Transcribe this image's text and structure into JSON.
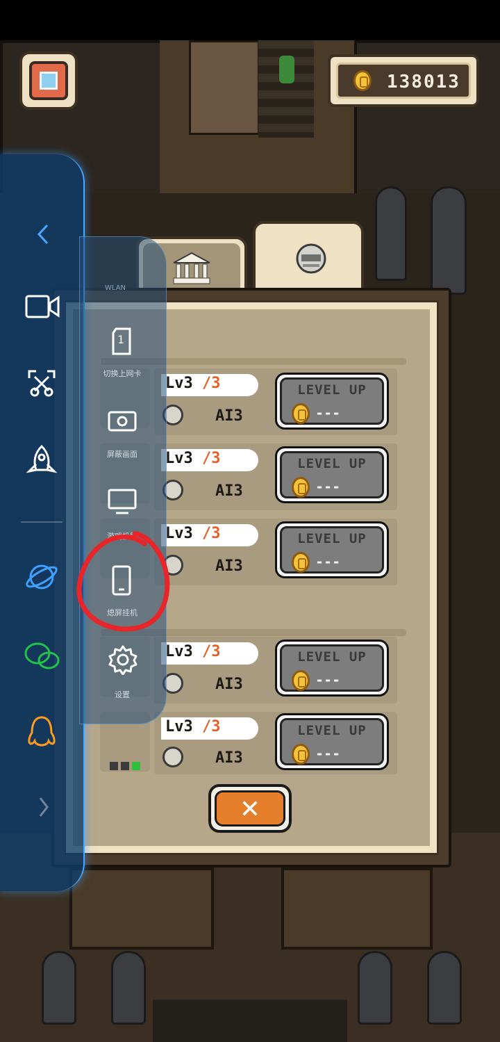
{
  "header": {
    "coins": "138013"
  },
  "tabs": [
    {
      "name": "museum",
      "icon": "museum-icon"
    },
    {
      "name": "robot",
      "icon": "robot-icon"
    }
  ],
  "upgrade_rows": [
    {
      "level": "Lv3",
      "max": "/3",
      "ai": "AI3",
      "button": "LEVEL UP",
      "cost": "---"
    },
    {
      "level": "Lv3",
      "max": "/3",
      "ai": "AI3",
      "button": "LEVEL UP",
      "cost": "---"
    },
    {
      "level": "Lv3",
      "max": "/3",
      "ai": "AI3",
      "button": "LEVEL UP",
      "cost": "---"
    },
    {
      "level": "Lv3",
      "max": "/3",
      "ai": "AI3",
      "button": "LEVEL UP",
      "cost": "---"
    },
    {
      "level": "Lv3",
      "max": "/3",
      "ai": "AI3",
      "button": "LEVEL UP",
      "cost": "---"
    }
  ],
  "close_button": "✕",
  "sidebar": {
    "items": [
      "back",
      "screen-record",
      "screenshot",
      "boost",
      "browser",
      "wechat",
      "qq",
      "more"
    ],
    "sub_items": [
      {
        "label": "切换上网卡",
        "icon": "sim-card-icon",
        "badge": "1"
      },
      {
        "label": "屏蔽画面",
        "icon": "camera-icon"
      },
      {
        "label": "游戏投屏",
        "icon": "screen-cast-icon"
      },
      {
        "label": "熄屏挂机",
        "icon": "phone-icon"
      },
      {
        "label": "设置",
        "icon": "gear-icon"
      }
    ],
    "wlan_label": "WLAN"
  },
  "colors": {
    "accent_red": "#e8262a",
    "panel_beige": "#efe3c4",
    "button_orange": "#e57f2c",
    "sidebar_blue": "#0e3e6e"
  }
}
